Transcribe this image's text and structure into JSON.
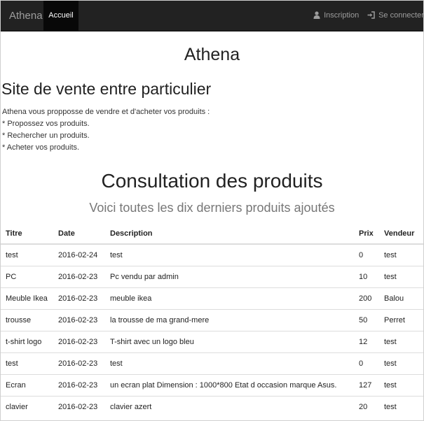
{
  "navbar": {
    "brand": "Athena",
    "active_item": "Accueil",
    "inscription": "Inscription",
    "login": "Se connecter",
    "icons": {
      "inscription": "user-icon",
      "login": "log-in-icon"
    }
  },
  "header": {
    "site_title": "Athena",
    "subtitle": "Site de vente entre particulier",
    "intro": [
      "Athena vous propposse de vendre et d'acheter vos produits :",
      "* Propossez vos produits.",
      "* Rechercher un produits.",
      "* Acheter vos produits."
    ]
  },
  "products": {
    "title": "Consultation des produits",
    "subtitle": "Voici toutes les dix derniers produits ajoutés",
    "columns": [
      "Titre",
      "Date",
      "Description",
      "Prix",
      "Vendeur"
    ],
    "rows": [
      [
        "test",
        "2016-02-24",
        "test",
        "0",
        "test"
      ],
      [
        "PC",
        "2016-02-23",
        "Pc vendu par admin",
        "10",
        "test"
      ],
      [
        "Meuble Ikea",
        "2016-02-23",
        "meuble ikea",
        "200",
        "Balou"
      ],
      [
        "trousse",
        "2016-02-23",
        "la trousse de ma grand-mere",
        "50",
        "Perret"
      ],
      [
        "t-shirt logo",
        "2016-02-23",
        "T-shirt avec un logo bleu",
        "12",
        "test"
      ],
      [
        "test",
        "2016-02-23",
        "test",
        "0",
        "test"
      ],
      [
        "Ecran",
        "2016-02-23",
        "un ecran plat Dimension : 1000*800 Etat d occasion marque Asus.",
        "127",
        "test"
      ],
      [
        "clavier",
        "2016-02-23",
        "clavier azert",
        "20",
        "test"
      ]
    ]
  }
}
